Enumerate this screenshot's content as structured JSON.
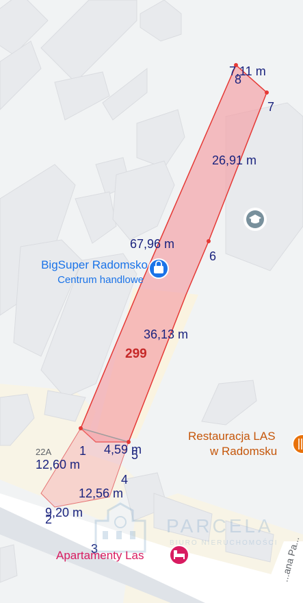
{
  "parcel": {
    "number": "299",
    "fill_color": "#f7b8b8",
    "stroke_color": "#e53935",
    "measurements": [
      "7,11 m",
      "26,91 m",
      "67,96 m",
      "36,13 m",
      "4,59 m",
      "12,60 m",
      "12,56 m",
      "9,20 m"
    ],
    "vertex_numbers": [
      "1",
      "2",
      "3",
      "4",
      "5",
      "6",
      "7",
      "8"
    ]
  },
  "places": {
    "shop": {
      "name": "BigSuper Radomsko",
      "category": "Centrum handlowe",
      "icon": "shopping-bag-icon",
      "color": "#1a73e8"
    },
    "restaurant": {
      "name_line1": "Restauracja LAS",
      "name_line2": "w Radomsku",
      "icon": "restaurant-icon",
      "color": "#e8710a"
    },
    "hotel": {
      "name": "Apartamenty Las",
      "icon": "bed-icon",
      "color": "#d81b60"
    },
    "school": {
      "icon": "graduation-cap-icon"
    }
  },
  "address_number": "22A",
  "street_name": "...ana Pa...",
  "watermark": {
    "text": "PARCELA",
    "subtitle": "BIURO NIERUCHOMOŚCI"
  }
}
